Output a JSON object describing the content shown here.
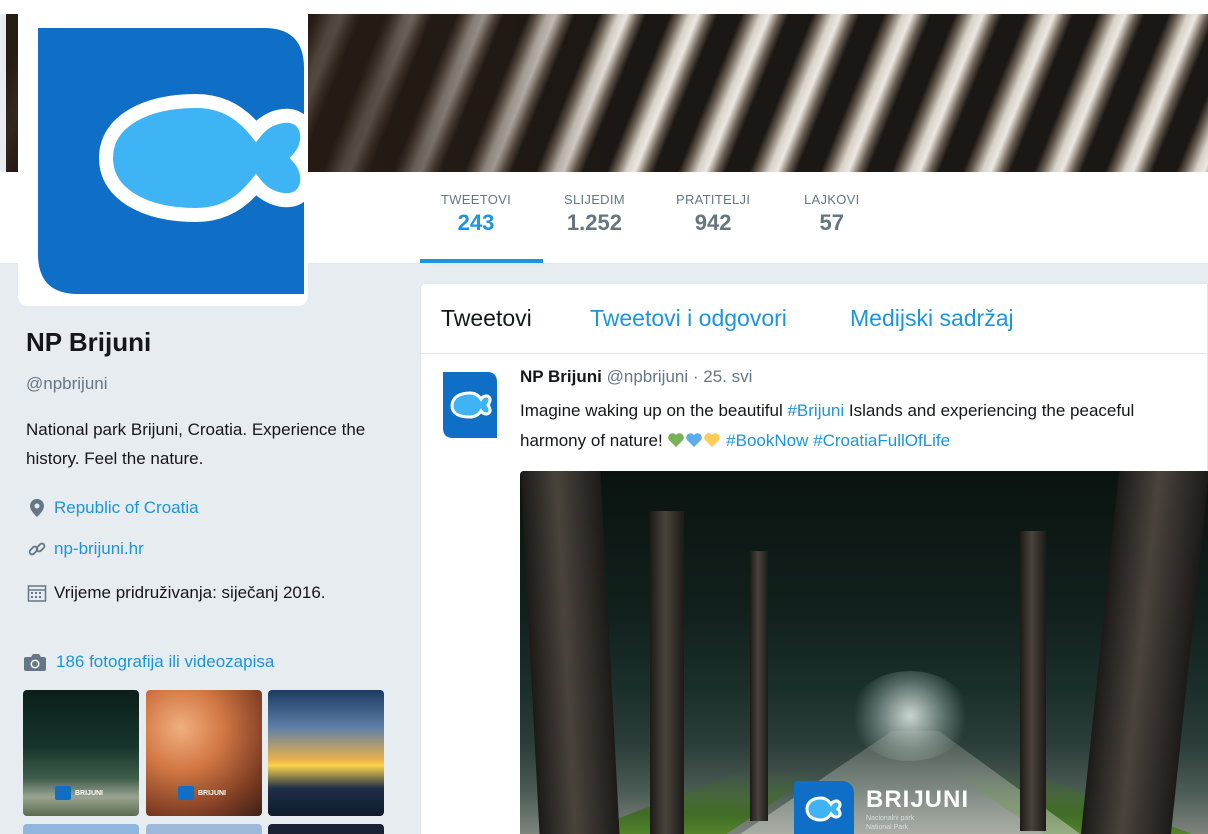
{
  "profile": {
    "name": "NP Brijuni",
    "handle": "@npbrijuni",
    "bio": "National park Brijuni, Croatia. Experience the history. Feel the nature.",
    "location": "Republic of Croatia",
    "website": "np-brijuni.hr",
    "joined": "Vrijeme pridruživanja: siječanj 2016.",
    "photos_label": "186 fotografija ili videozapisa"
  },
  "stats": [
    {
      "label": "TWEETOVI",
      "value": "243"
    },
    {
      "label": "SLIJEDIM",
      "value": "1.252"
    },
    {
      "label": "PRATITELJI",
      "value": "942"
    },
    {
      "label": "LAJKOVI",
      "value": "57"
    }
  ],
  "timeline_tabs": [
    "Tweetovi",
    "Tweetovi i odgovori",
    "Medijski sadržaj"
  ],
  "tweet": {
    "author": "NP Brijuni",
    "handle": "@npbrijuni",
    "date": "· 25. svi",
    "text_1": "Imagine waking up on the beautiful ",
    "tag_brijuni": "#Brijuni",
    "text_2": " Islands and experiencing the peaceful harmony of nature! ",
    "tag_booknow": "#BookNow",
    "tag_croatia": "#CroatiaFullOfLife",
    "media_logo_word": "BRIJUNI",
    "media_logo_sub1": "Nacionalni park",
    "media_logo_sub2": "National Park"
  },
  "thumb_logo_word": "BRIJUNI",
  "colors": {
    "accent": "#1b95e0",
    "brand_blue": "#0f6fc6",
    "fish_light": "#3fb4f5",
    "heart_green": "#77b255",
    "heart_blue": "#5dadec",
    "heart_yellow": "#fdcb58"
  }
}
